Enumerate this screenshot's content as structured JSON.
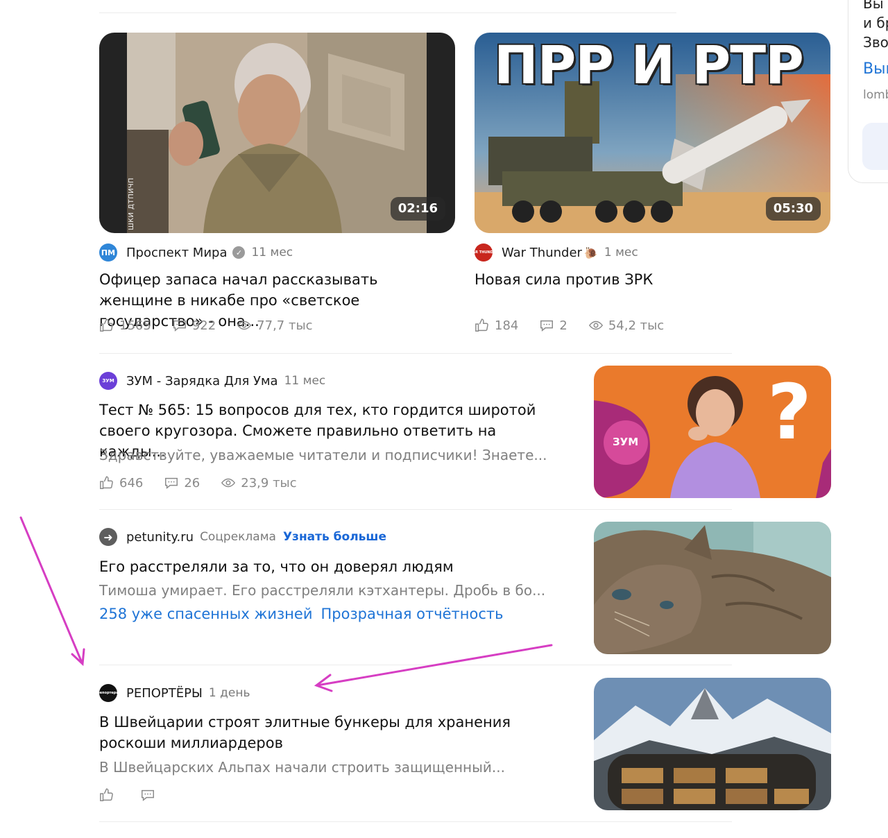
{
  "side_card": {
    "line1": "Вы",
    "line2": "и бр",
    "line3": "Зво",
    "link": "Вык",
    "domain": "lomb"
  },
  "video_feed": [
    {
      "channel": "Проспект Мира",
      "avatar_text": "ПМ",
      "verified": true,
      "ago": "11 мес",
      "title": "Офицер запаса начал рассказывать женщине в никабе про «светское государство» - она...",
      "duration": "02:16",
      "thumb_text": "шки дтпичп",
      "likes": "1565",
      "comments": "922",
      "views": "77,7 тыс"
    },
    {
      "channel": "War Thunder",
      "avatar_text": "WAR THUNDER",
      "channel_emoji": "🐌",
      "ago": "1 мес",
      "title": "Новая сила против ЗРК",
      "duration": "05:30",
      "thumb_title": "ПРР И РТР",
      "likes": "184",
      "comments": "2",
      "views": "54,2 тыс"
    }
  ],
  "articles": [
    {
      "channel": "ЗУМ - Зарядка Для Ума",
      "avatar_text": "ЗУМ",
      "ago": "11 мес",
      "title": "Тест № 565: 15 вопросов для тех, кто гордится широтой своего кругозора. Сможете правильно ответить на кажды...",
      "snippet": "Здравствуйте, уважаемые читатели и подписчики! Знаете...",
      "thumb_label": "ЗУМ",
      "likes": "646",
      "comments": "26",
      "views": "23,9 тыс"
    },
    {
      "channel": "petunity.ru",
      "ad_label": "Соцреклама",
      "cta": "Узнать больше",
      "title": "Его расстреляли за то, что он доверял людям",
      "snippet": "Тимоша умирает. Его расстреляли кэтхантеры. Дробь в бо...",
      "links": [
        "258 уже спасенных жизней",
        "Прозрачная отчётность"
      ]
    },
    {
      "channel": "РЕПОРТЁРЫ",
      "avatar_text": "репортеры",
      "ago": "1 день",
      "title": "В Швейцарии строят элитные бункеры для хранения роскоши миллиардеров",
      "snippet": "В Швейцарских Альпах начали строить защищенный..."
    }
  ],
  "colors": {
    "link": "#1f74d6",
    "annotation_arrow": "#d63ec3"
  }
}
